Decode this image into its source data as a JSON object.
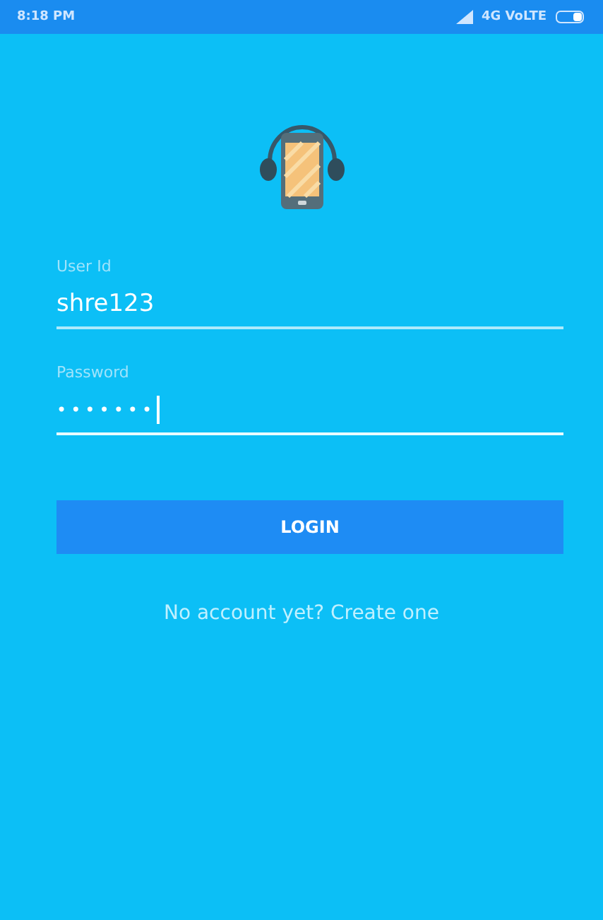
{
  "status_bar": {
    "time": "8:18 PM",
    "network": "4G VoLTE"
  },
  "user_id": {
    "label": "User Id",
    "value": "shre123"
  },
  "password": {
    "label": "Password",
    "masked_value": "•••••••",
    "focused": true
  },
  "login_button": "LOGIN",
  "signup_link": "No account yet? Create one"
}
